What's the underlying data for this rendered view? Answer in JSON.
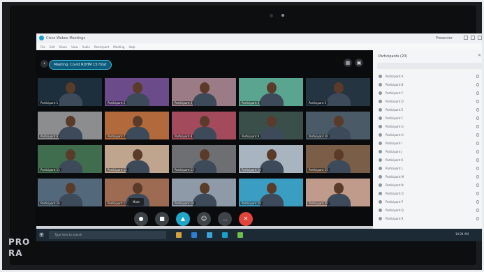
{
  "watermark": {
    "line1": "PRO",
    "line2": "RA"
  },
  "app": {
    "title": "Cisco Webex Meetings",
    "window_title": "Webex Meet...",
    "user": "Presenter",
    "menu": [
      "File",
      "Edit",
      "Share",
      "View",
      "Audio",
      "Participant",
      "Meeting",
      "Help"
    ]
  },
  "meeting": {
    "pill_label": "Meeting: Covid ROHM 15 Host",
    "back_icon": "back-arrow-icon",
    "layout_icons": [
      "grid-view-icon",
      "speaker-view-icon"
    ]
  },
  "tooltip": "Mute",
  "tiles": [
    {
      "name": "Participant 1",
      "bg": "#1d2e3c"
    },
    {
      "name": "Participant 2",
      "bg": "#6b4b8a"
    },
    {
      "name": "Participant 3",
      "bg": "#9a7b86"
    },
    {
      "name": "Participant 4",
      "bg": "#5aa58f"
    },
    {
      "name": "Participant 5",
      "bg": "#243441"
    },
    {
      "name": "Participant 6",
      "bg": "#8c8d8f"
    },
    {
      "name": "Participant 7",
      "bg": "#b26a3d"
    },
    {
      "name": "Participant 8",
      "bg": "#a34b5c"
    },
    {
      "name": "Participant 9",
      "bg": "#3b4f4a"
    },
    {
      "name": "Participant 10",
      "bg": "#4a5a66"
    },
    {
      "name": "Participant 11",
      "bg": "#3f6d4e"
    },
    {
      "name": "Participant 12",
      "bg": "#bfa48e"
    },
    {
      "name": "Participant 13",
      "bg": "#6d6f72"
    },
    {
      "name": "Participant 14",
      "bg": "#a9b4c1"
    },
    {
      "name": "Participant 15",
      "bg": "#7b5e48"
    },
    {
      "name": "Participant 16",
      "bg": "#53687b"
    },
    {
      "name": "Participant 17",
      "bg": "#9d6b52"
    },
    {
      "name": "Participant 18",
      "bg": "#8e9aa8"
    },
    {
      "name": "Participant 19",
      "bg": "#3a9ec2"
    },
    {
      "name": "Participant 20",
      "bg": "#c09a8a"
    }
  ],
  "controls": [
    {
      "icon": "mic-icon",
      "color": "#3e4348",
      "glyph": "●"
    },
    {
      "icon": "video-icon",
      "color": "#3e4348",
      "glyph": "■"
    },
    {
      "icon": "share-icon",
      "color": "#1ea7c9",
      "glyph": "▲"
    },
    {
      "icon": "participants-icon",
      "color": "#3e4348",
      "glyph": "☺"
    },
    {
      "icon": "more-icon",
      "color": "#3e4348",
      "glyph": "…"
    },
    {
      "icon": "end-call-icon",
      "color": "#e0443a",
      "glyph": "✕"
    }
  ],
  "panel": {
    "title": "Participants (20)",
    "items": [
      "Participant A",
      "Participant B",
      "Participant C",
      "Participant D",
      "Participant E",
      "Participant F",
      "Participant G",
      "Participant H",
      "Participant I",
      "Participant J",
      "Participant K",
      "Participant L",
      "Participant M",
      "Participant N",
      "Participant O",
      "Participant P",
      "Participant Q",
      "Participant R"
    ]
  },
  "taskbar": {
    "search_placeholder": "Type here to search",
    "time": "10:24 AM",
    "icon_colors": [
      "#d6a13a",
      "#2f7fd1",
      "#3aa3d6",
      "#1aa0c8",
      "#6cc04a"
    ]
  }
}
